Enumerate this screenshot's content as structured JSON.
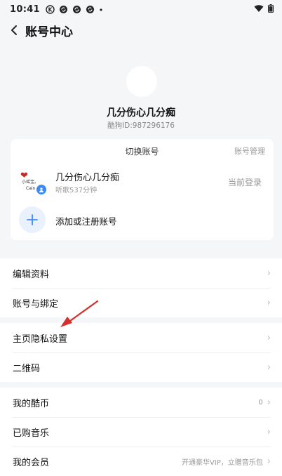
{
  "status_bar": {
    "time": "10:41",
    "icons": [
      "k-icon",
      "sync-icon",
      "sync-icon",
      "sync-icon",
      "dot-icon"
    ],
    "right_icons": [
      "wifi-icon",
      "battery-icon"
    ]
  },
  "nav": {
    "title": "账号中心"
  },
  "profile": {
    "name": "几分伤心几分痴",
    "id_text": "酷狗ID:987296176"
  },
  "switch_card": {
    "title": "切换账号",
    "manage_label": "账号管理",
    "account": {
      "name": "几分伤心几分痴",
      "listen_time": "听歌537分钟",
      "status": "当前登录",
      "avatar_text_top": "小瑶宝。",
      "avatar_text_bottom": "Cain"
    },
    "add_label": "添加或注册账号"
  },
  "menu_groups": [
    {
      "items": [
        {
          "label": "编辑资料"
        },
        {
          "label": "账号与绑定"
        }
      ]
    },
    {
      "items": [
        {
          "label": "主页隐私设置"
        },
        {
          "label": "二维码"
        }
      ]
    },
    {
      "items": [
        {
          "label": "我的酷币",
          "value": "0"
        },
        {
          "label": "已购音乐"
        },
        {
          "label": "我的会员",
          "value": "开通豪华VIP，立赠音乐包"
        }
      ]
    }
  ],
  "colors": {
    "accent": "#3d8bf2",
    "annotation_arrow": "#d32f2f",
    "background": "#f5f6f8"
  }
}
